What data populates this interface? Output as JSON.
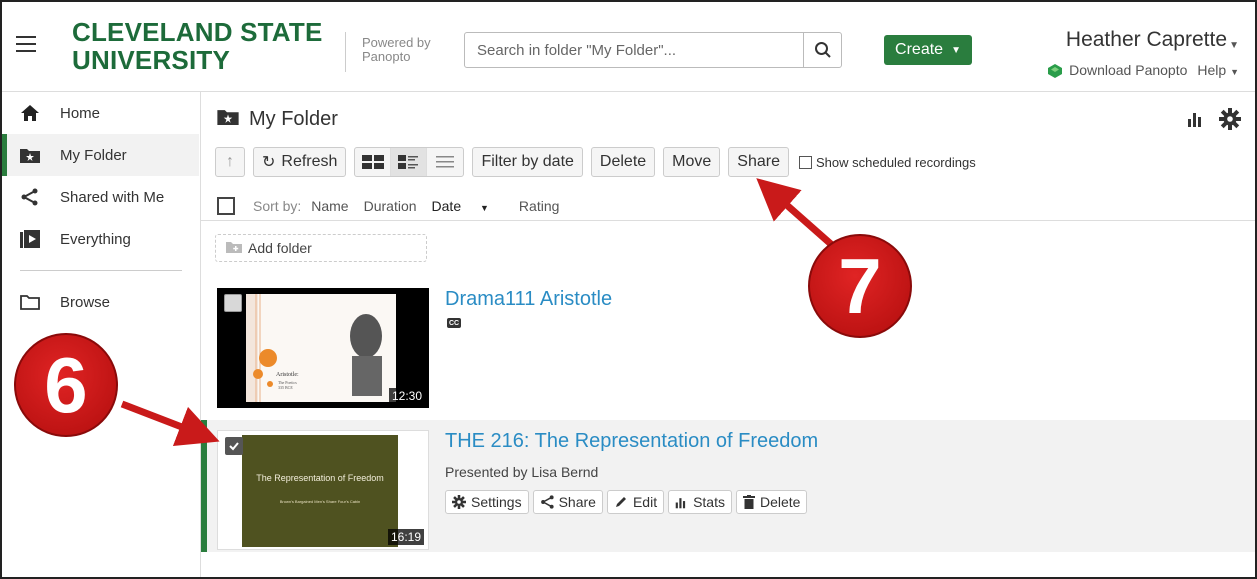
{
  "header": {
    "logo_line1": "CLEVELAND STATE",
    "logo_line2": "UNIVERSITY",
    "powered_line1": "Powered by",
    "powered_line2": "Panopto",
    "search_placeholder": "Search in folder \"My Folder\"...",
    "create_label": "Create",
    "user_name": "Heather Caprette",
    "download_label": "Download Panopto",
    "help_label": "Help"
  },
  "sidebar": {
    "items": [
      {
        "label": "Home",
        "icon": "home-icon"
      },
      {
        "label": "My Folder",
        "icon": "star-folder-icon",
        "active": true
      },
      {
        "label": "Shared with Me",
        "icon": "share-icon"
      },
      {
        "label": "Everything",
        "icon": "play-stack-icon"
      },
      {
        "label": "Browse",
        "icon": "folder-icon"
      }
    ]
  },
  "main": {
    "folder_title": "My Folder",
    "toolbar": {
      "refresh": "Refresh",
      "filter": "Filter by date",
      "delete": "Delete",
      "move": "Move",
      "share": "Share",
      "show_scheduled": "Show scheduled recordings"
    },
    "sort": {
      "label": "Sort by:",
      "name": "Name",
      "duration": "Duration",
      "date": "Date",
      "rating": "Rating"
    },
    "add_folder": "Add folder",
    "sessions": [
      {
        "title": "Drama111 Aristotle",
        "duration": "12:30",
        "slide_title": "Aristotle:",
        "slide_sub": "The Poetics",
        "slide_sub2": "335 BCE",
        "has_cc": true,
        "selected": false
      },
      {
        "title": "THE 216: The Representation of Freedom",
        "duration": "16:19",
        "presenter": "Presented by Lisa Bernd",
        "slide_title": "The Representation of Freedom",
        "slide_sub": "Brown's Bargained Men's Share Four's Cabin",
        "selected": true,
        "actions": [
          "Settings",
          "Share",
          "Edit",
          "Stats",
          "Delete"
        ]
      }
    ]
  },
  "annotations": {
    "badge_6": "6",
    "badge_7": "7"
  },
  "colors": {
    "brand_green": "#2a7d3e",
    "link_blue": "#2a8cc4",
    "badge_red": "#d41f1f"
  }
}
